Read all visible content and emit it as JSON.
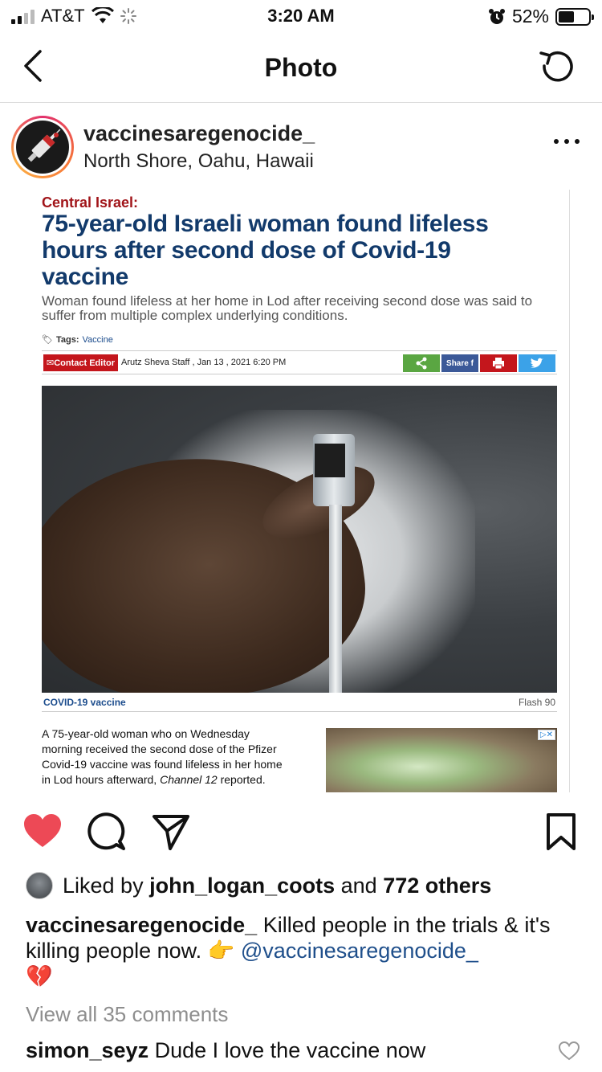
{
  "status_bar": {
    "carrier": "AT&T",
    "time": "3:20 AM",
    "battery_percent": "52%",
    "battery_level": 0.52
  },
  "nav": {
    "title": "Photo"
  },
  "post": {
    "username": "vaccinesaregenocide_",
    "location": "North Shore, Oahu, Hawaii"
  },
  "article": {
    "kicker": "Central Israel:",
    "headline": "75-year-old Israeli woman found lifeless hours after second dose of Covid-19 vaccine",
    "subhead": "Woman found lifeless at her home in Lod after receiving second dose was said to suffer from multiple complex underlying conditions.",
    "tags_label": "Tags:",
    "tag": "Vaccine",
    "contact_editor": "Contact Editor",
    "byline": "Arutz Sheva Staff ,  Jan 13 , 2021 6:20 PM",
    "share_label": "Share",
    "photo_caption": "COVID-19 vaccine",
    "photo_credit": "Flash 90",
    "body_part1": "A 75-year-old woman who on Wednesday morning received the second dose of the Pfizer Covid-19 vaccine was found lifeless in her home in Lod hours afterward, ",
    "body_source": "Channel 12",
    "body_part2": " reported.",
    "ad_badge": "▷✕",
    "colors": {
      "kicker": "#a1151a",
      "headline": "#123a6b"
    }
  },
  "likes": {
    "prefix": "Liked by",
    "user": "john_logan_coots",
    "connector": "and",
    "others": "772 others"
  },
  "caption": {
    "user": "vaccinesaregenocide_",
    "text": "Killed people in the trials & it's killing people now.",
    "emoji_point": "👉",
    "mention": "@vaccinesaregenocide_",
    "emoji_heart": "💔"
  },
  "comments": {
    "view_all": "View all 35 comments",
    "first_user": "simon_seyz",
    "first_text": "Dude I love the vaccine now"
  },
  "colors": {
    "like_red": "#ed4956",
    "mention_blue": "#1f4f8b"
  }
}
